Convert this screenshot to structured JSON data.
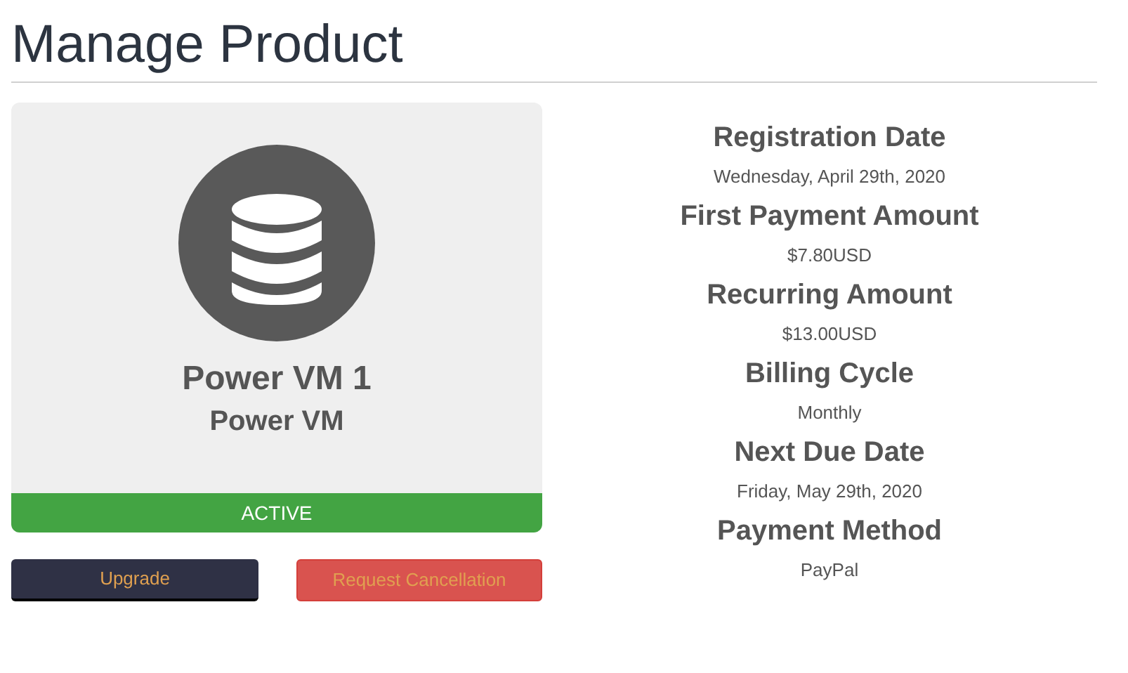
{
  "page_title": "Manage Product",
  "product": {
    "name": "Power VM 1",
    "group": "Power VM",
    "status": {
      "label": "ACTIVE",
      "kind": "active"
    }
  },
  "buttons": [
    {
      "label": "Upgrade",
      "kind": "primary"
    },
    {
      "label": "Request Cancellation",
      "kind": "danger"
    }
  ],
  "details": [
    {
      "label": "Registration Date",
      "value": "Wednesday, April 29th, 2020"
    },
    {
      "label": "First Payment Amount",
      "value": "$7.80USD"
    },
    {
      "label": "Recurring Amount",
      "value": "$13.00USD"
    },
    {
      "label": "Billing Cycle",
      "value": "Monthly"
    },
    {
      "label": "Next Due Date",
      "value": "Friday, May 29th, 2020"
    },
    {
      "label": "Payment Method",
      "value": "PayPal"
    }
  ]
}
